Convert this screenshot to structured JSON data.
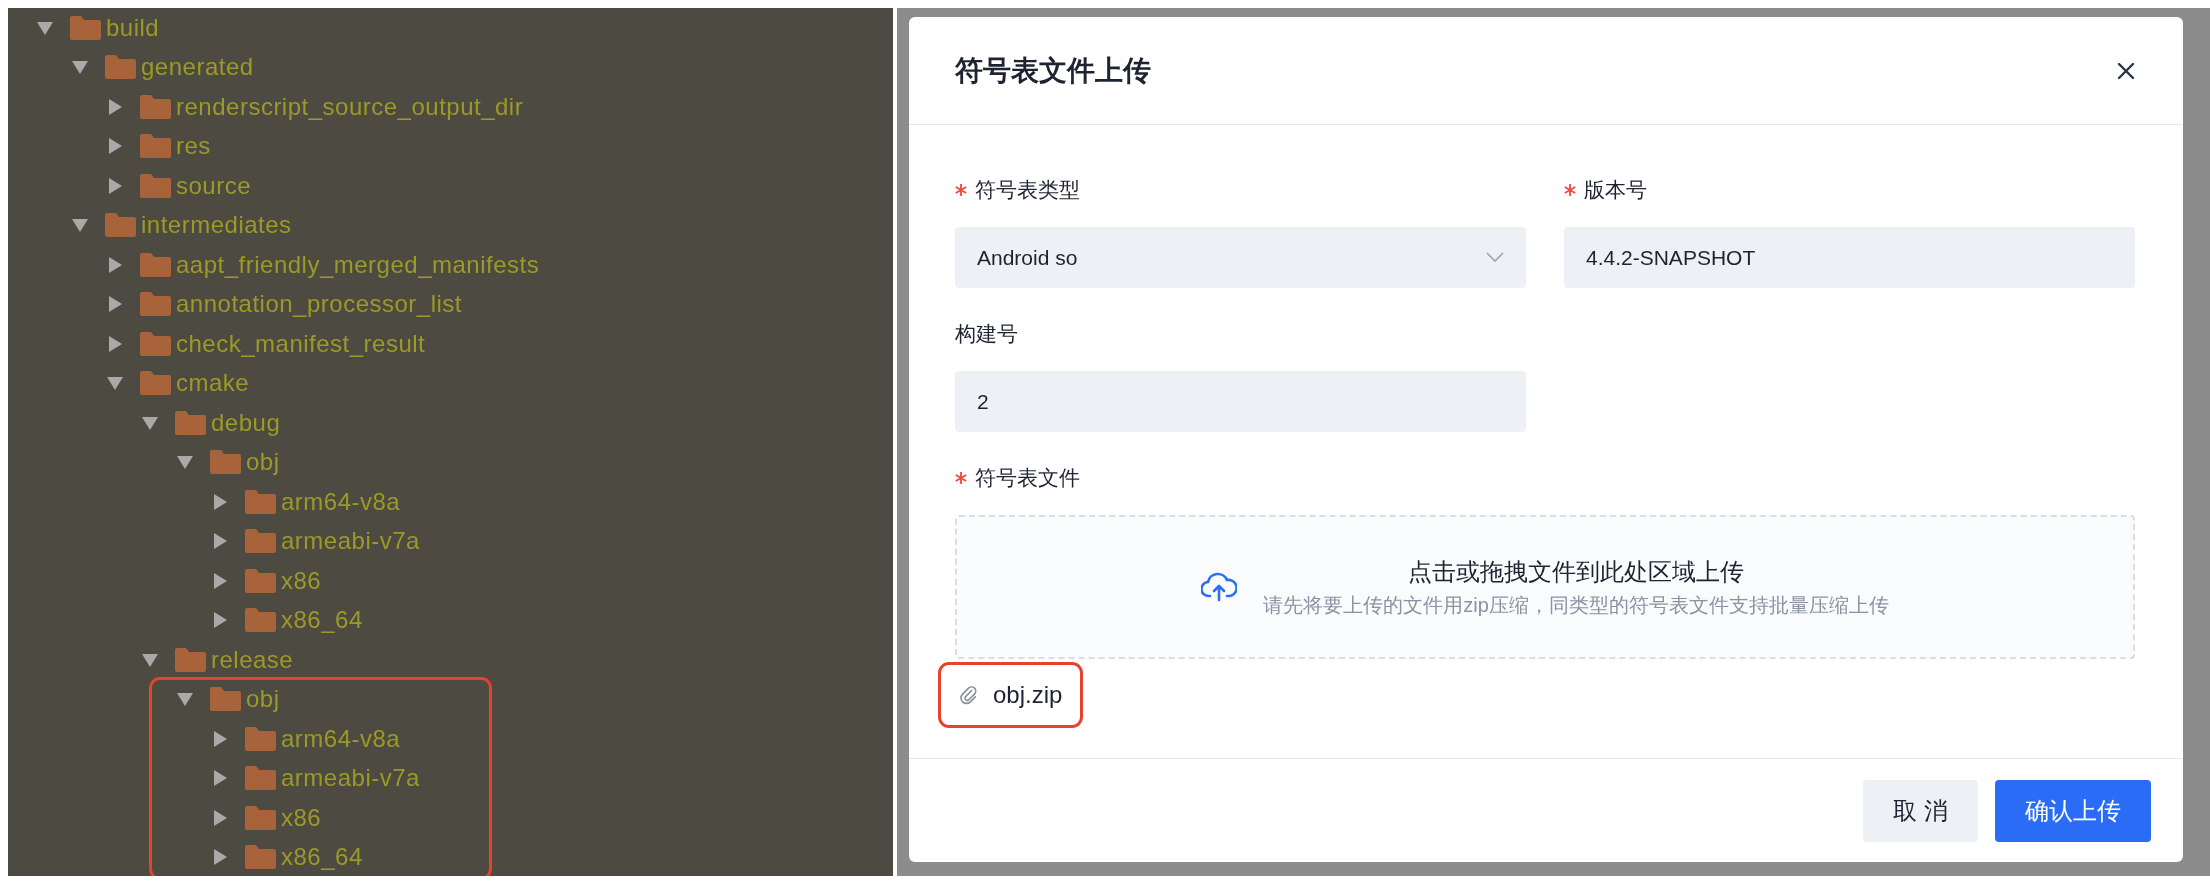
{
  "tree": [
    {
      "label": "build",
      "expanded": true,
      "children": [
        {
          "label": "generated",
          "expanded": true,
          "children": [
            {
              "label": "renderscript_source_output_dir",
              "expanded": false
            },
            {
              "label": "res",
              "expanded": false
            },
            {
              "label": "source",
              "expanded": false
            }
          ]
        },
        {
          "label": "intermediates",
          "expanded": true,
          "children": [
            {
              "label": "aapt_friendly_merged_manifests",
              "expanded": false
            },
            {
              "label": "annotation_processor_list",
              "expanded": false
            },
            {
              "label": "check_manifest_result",
              "expanded": false
            },
            {
              "label": "cmake",
              "expanded": true,
              "children": [
                {
                  "label": "debug",
                  "expanded": true,
                  "children": [
                    {
                      "label": "obj",
                      "expanded": true,
                      "children": [
                        {
                          "label": "arm64-v8a",
                          "expanded": false
                        },
                        {
                          "label": "armeabi-v7a",
                          "expanded": false
                        },
                        {
                          "label": "x86",
                          "expanded": false
                        },
                        {
                          "label": "x86_64",
                          "expanded": false
                        }
                      ]
                    }
                  ]
                },
                {
                  "label": "release",
                  "expanded": true,
                  "children": [
                    {
                      "label": "obj",
                      "expanded": true,
                      "highlighted": true,
                      "children": [
                        {
                          "label": "arm64-v8a",
                          "expanded": false
                        },
                        {
                          "label": "armeabi-v7a",
                          "expanded": false
                        },
                        {
                          "label": "x86",
                          "expanded": false
                        },
                        {
                          "label": "x86_64",
                          "expanded": false
                        }
                      ]
                    }
                  ]
                }
              ]
            }
          ]
        }
      ]
    }
  ],
  "dialog": {
    "title": "符号表文件上传",
    "fields": [
      {
        "label": "符号表类型",
        "required": true,
        "kind": "select",
        "value": "Android so"
      },
      {
        "label": "版本号",
        "required": true,
        "kind": "text",
        "value": "4.4.2-SNAPSHOT"
      },
      {
        "label": "构建号",
        "required": false,
        "kind": "text",
        "value": "2"
      }
    ],
    "upload": {
      "label": "符号表文件",
      "required": true,
      "title": "点击或拖拽文件到此处区域上传",
      "hint": "请先将要上传的文件用zip压缩，同类型的符号表文件支持批量压缩上传"
    },
    "attachments": [
      {
        "name": "obj.zip",
        "highlighted": true
      }
    ],
    "buttons": [
      {
        "label": "取 消",
        "kind": "secondary"
      },
      {
        "label": "确认上传",
        "kind": "primary"
      }
    ]
  }
}
